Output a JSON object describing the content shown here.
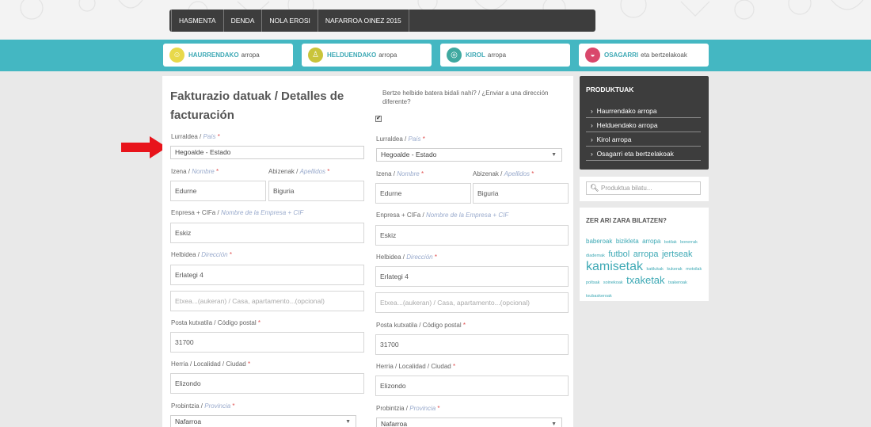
{
  "nav": [
    "HASMENTA",
    "DENDA",
    "NOLA EROSI",
    "NAFARROA OINEZ 2015"
  ],
  "categories": [
    {
      "bold": "HAURRENDAKO",
      "rest": "arropa",
      "color": "#e8d94a",
      "icon": "child-icon"
    },
    {
      "bold": "HELDUENDAKO",
      "rest": "arropa",
      "color": "#c9c43a",
      "icon": "adult-icon"
    },
    {
      "bold": "KIROL",
      "rest": "arropa",
      "color": "#3fa9a0",
      "icon": "ball-icon"
    },
    {
      "bold": "OSAGARRI",
      "rest": "eta bertzelakoak",
      "color": "#d9476b",
      "icon": "cap-icon"
    }
  ],
  "billing": {
    "title": "Fakturazio datuak / Detalles de facturación",
    "country_label": "Lurraldea /",
    "country_label_es": "País",
    "country_value": "Hegoalde - Estado",
    "name_label": "Izena /",
    "name_label_es": "Nombre",
    "surname_label": "Abizenak /",
    "surname_label_es": "Apellidos",
    "name_value": "Edurne",
    "surname_value": "Biguria",
    "company_label": "Enpresa + CIFa /",
    "company_label_es": "Nombre de la Empresa + CIF",
    "company_value": "Eskiz",
    "address_label": "Helbidea /",
    "address_label_es": "Dirección",
    "address_value": "Erlategi 4",
    "address2_placeholder": "Etxea...(aukeran) / Casa, apartamento...(opcional)",
    "postal_label": "Posta kutxatila / Código postal",
    "postal_value": "31700",
    "city_label": "Herria / Localidad / Ciudad",
    "city_value": "Elizondo",
    "province_label": "Probintzia /",
    "province_label_es": "Provincia",
    "province_value": "Nafarroa"
  },
  "shipping": {
    "question": "Bertze helbide batera bidali nahi? / ¿Enviar a una dirección diferente?",
    "checked": "✔"
  },
  "required_mark": "*",
  "sidebar": {
    "heading": "PRODUKTUAK",
    "items": [
      "Haurrendako arropa",
      "Helduendako arropa",
      "Kirol arropa",
      "Osagarri eta bertzelakoak"
    ],
    "search_placeholder": "Produktua bilatu...",
    "tags_heading": "ZER ARI ZARA BILATZEN?",
    "tags": [
      {
        "t": "baberoak",
        "s": 8
      },
      {
        "t": "bizikleta",
        "s": 8
      },
      {
        "t": "arropa",
        "s": 8
      },
      {
        "t": "botilak",
        "s": 5.5
      },
      {
        "t": "bonerrak",
        "s": 5.5
      },
      {
        "t": "diademak",
        "s": 5.5
      },
      {
        "t": "futbol",
        "s": 11
      },
      {
        "t": "arropa",
        "s": 11
      },
      {
        "t": "jertseak",
        "s": 11
      },
      {
        "t": "kamisetak",
        "s": 16
      },
      {
        "t": "katilukak",
        "s": 5.5
      },
      {
        "t": "kukerak",
        "s": 5.5
      },
      {
        "t": "motxilak",
        "s": 5.5
      },
      {
        "t": "poltsak",
        "s": 5.5
      },
      {
        "t": "soinekoak",
        "s": 5.5
      },
      {
        "t": "txaketak",
        "s": 13
      },
      {
        "t": "txakeroak",
        "s": 5.5
      },
      {
        "t": "txubaskeroak",
        "s": 5.5
      }
    ]
  }
}
